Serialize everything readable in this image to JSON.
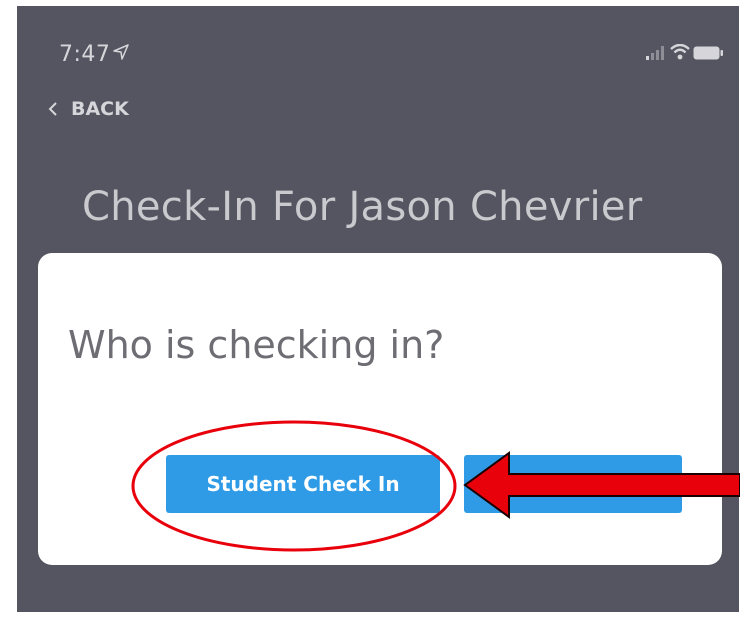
{
  "status_bar": {
    "time": "7:47",
    "icons": [
      "location-arrow-icon",
      "signal-icon",
      "wifi-icon",
      "battery-icon"
    ]
  },
  "nav": {
    "back_label": "BACK"
  },
  "page": {
    "title": "Check-In For Jason Chevrier"
  },
  "dialog": {
    "question": "Who is checking in?",
    "student_button_label": "Student Check In",
    "other_button_label": ""
  },
  "colors": {
    "background": "#545560",
    "dialog": "#ffffff",
    "button": "#2f9be6",
    "annotation": "#e8000b"
  }
}
